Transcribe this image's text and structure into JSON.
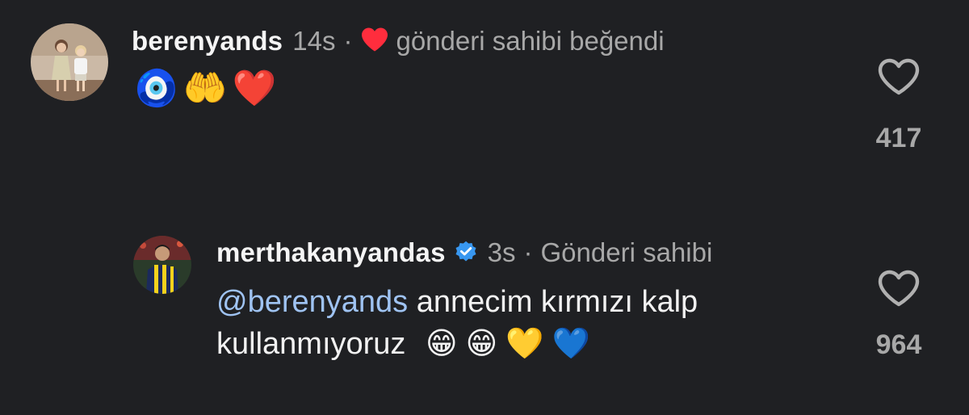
{
  "comments": [
    {
      "username": "berenyands",
      "time": "14s",
      "separator": "·",
      "liked_by_author_label": "gönderi sahibi beğendi",
      "emojis": [
        "🧿",
        "🤲",
        "❤️"
      ],
      "avatar_icon": "avatar-two-children-photo",
      "like_count": "417",
      "colors": {
        "heart": "#ff2d3d"
      }
    },
    {
      "username": "merthakanyandas",
      "verified": true,
      "time": "3s",
      "separator": "·",
      "author_label": "Gönderi sahibi",
      "mention": "@berenyands",
      "text_line1": " annecim kırmızı kalp",
      "text_line2": "kullanmıyoruz",
      "emojis": [
        "😁",
        "😁",
        "💛",
        "💙"
      ],
      "avatar_icon": "avatar-footballer-photo",
      "like_count": "964",
      "colors": {
        "verified_badge": "#3897f0",
        "mention": "#9fc3f2"
      }
    }
  ],
  "theme": {
    "background": "#1f2023",
    "text": "#f2f2f2",
    "muted": "#a8a8a8"
  }
}
